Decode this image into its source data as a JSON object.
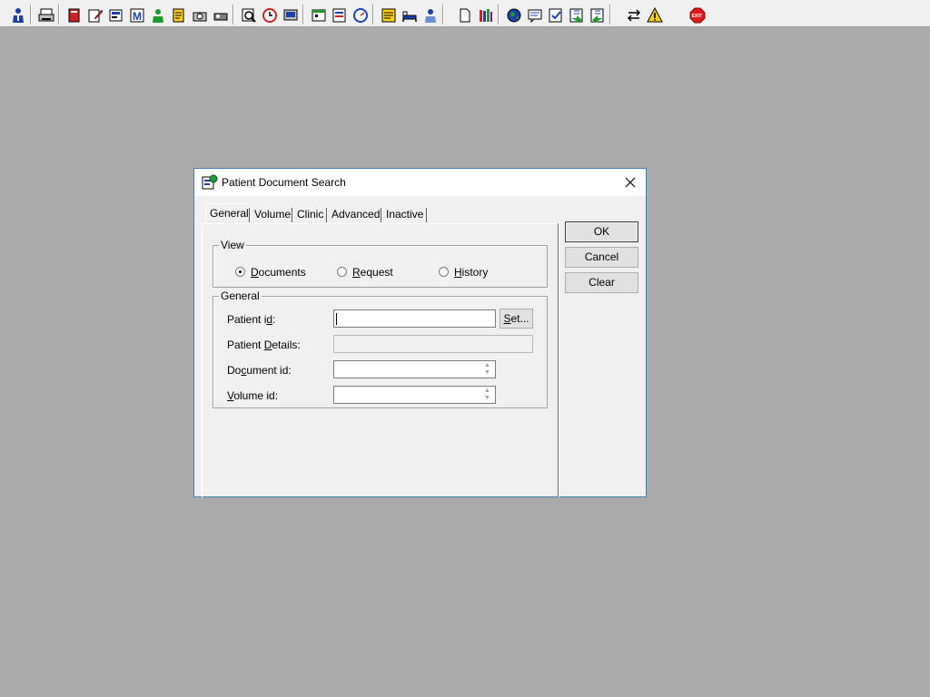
{
  "toolbar": {
    "exit_label": "EXIT",
    "colors": {
      "red": "#cc2222",
      "blue": "#1a3fa8",
      "yellow": "#ffd21e",
      "green": "#1e9a2f"
    }
  },
  "dialog": {
    "title": "Patient Document Search",
    "tabs": [
      {
        "label": "General",
        "active": true
      },
      {
        "label": "Volume",
        "active": false
      },
      {
        "label": "Clinic",
        "active": false
      },
      {
        "label": "Advanced",
        "active": false
      },
      {
        "label": "Inactive",
        "active": false
      }
    ],
    "view_group": {
      "label": "View",
      "options": [
        {
          "label_pre": "",
          "mnemonic": "D",
          "label_post": "ocuments",
          "selected": true
        },
        {
          "label_pre": "",
          "mnemonic": "R",
          "label_post": "equest",
          "selected": false
        },
        {
          "label_pre": "",
          "mnemonic": "H",
          "label_post": "istory",
          "selected": false
        }
      ]
    },
    "general_group": {
      "label": "General",
      "patient_id_label_pre": "Patient i",
      "patient_id_label_mn": "d",
      "patient_id_label_post": ":",
      "patient_id_value": "",
      "set_button_mn": "S",
      "set_button_post": "et...",
      "patient_details_label_pre": "Patient ",
      "patient_details_label_mn": "D",
      "patient_details_label_post": "etails:",
      "patient_details_value": "",
      "document_id_label_pre": "Do",
      "document_id_label_mn": "c",
      "document_id_label_post": "ument id:",
      "document_id_value": "",
      "volume_id_label_pre": "",
      "volume_id_label_mn": "V",
      "volume_id_label_post": "olume id:",
      "volume_id_value": ""
    },
    "buttons": {
      "ok": "OK",
      "cancel": "Cancel",
      "clear": "Clear"
    }
  }
}
